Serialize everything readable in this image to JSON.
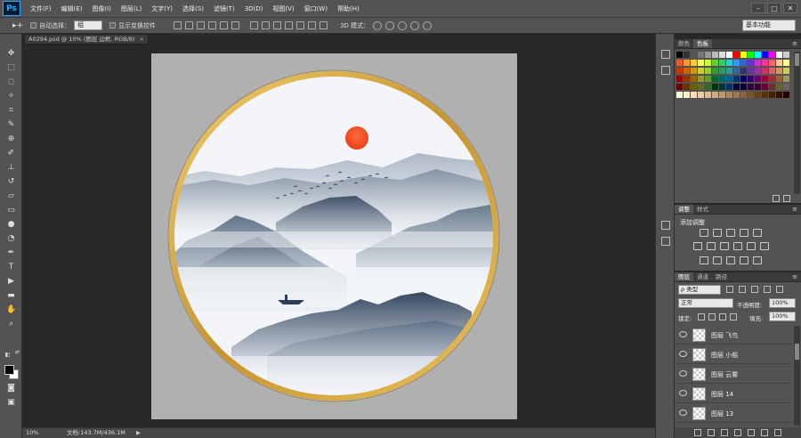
{
  "app": {
    "logo": "Ps"
  },
  "menu": [
    "文件(F)",
    "编辑(E)",
    "图像(I)",
    "图层(L)",
    "文字(Y)",
    "选择(S)",
    "滤镜(T)",
    "3D(D)",
    "视图(V)",
    "窗口(W)",
    "帮助(H)"
  ],
  "window_controls": {
    "minimize": "–",
    "maximize": "□",
    "close": "✕"
  },
  "options": {
    "tool_icon": "▸+",
    "auto_select_label": "自动选择：",
    "auto_select_value": "组",
    "show_transform_label": "显示变换控件",
    "mode_label": "3D 模式：",
    "workspace": "基本功能"
  },
  "document": {
    "tab_title": "A0294.psd @ 10% (图层 边框, RGB/8)",
    "close": "×"
  },
  "status": {
    "zoom": "10%",
    "doc_size": "文档:143.7M/436.1M",
    "arrow": "▶"
  },
  "panels": {
    "color": {
      "tabs": [
        "颜色",
        "色板"
      ],
      "active": 1
    },
    "adjust": {
      "tabs": [
        "调整",
        "样式"
      ],
      "active": 0,
      "title": "添加调整"
    },
    "layers": {
      "tabs": [
        "图层",
        "通道",
        "路径"
      ],
      "active": 0,
      "filter_kind": "ρ 类型",
      "blend_mode": "正常",
      "opacity_label": "不透明度:",
      "opacity": "100%",
      "lock_label": "锁定:",
      "fill_label": "填充:",
      "fill": "100%",
      "layers": [
        "图层 飞鸟",
        "图层 小船",
        "图层 云雾",
        "图层 14",
        "图层 13"
      ]
    }
  },
  "colors": {
    "sun": "#e8401c",
    "frame_gold": "#d4a53c",
    "mountain_dark": "#2c3f58",
    "mist": "#eef1f5"
  }
}
